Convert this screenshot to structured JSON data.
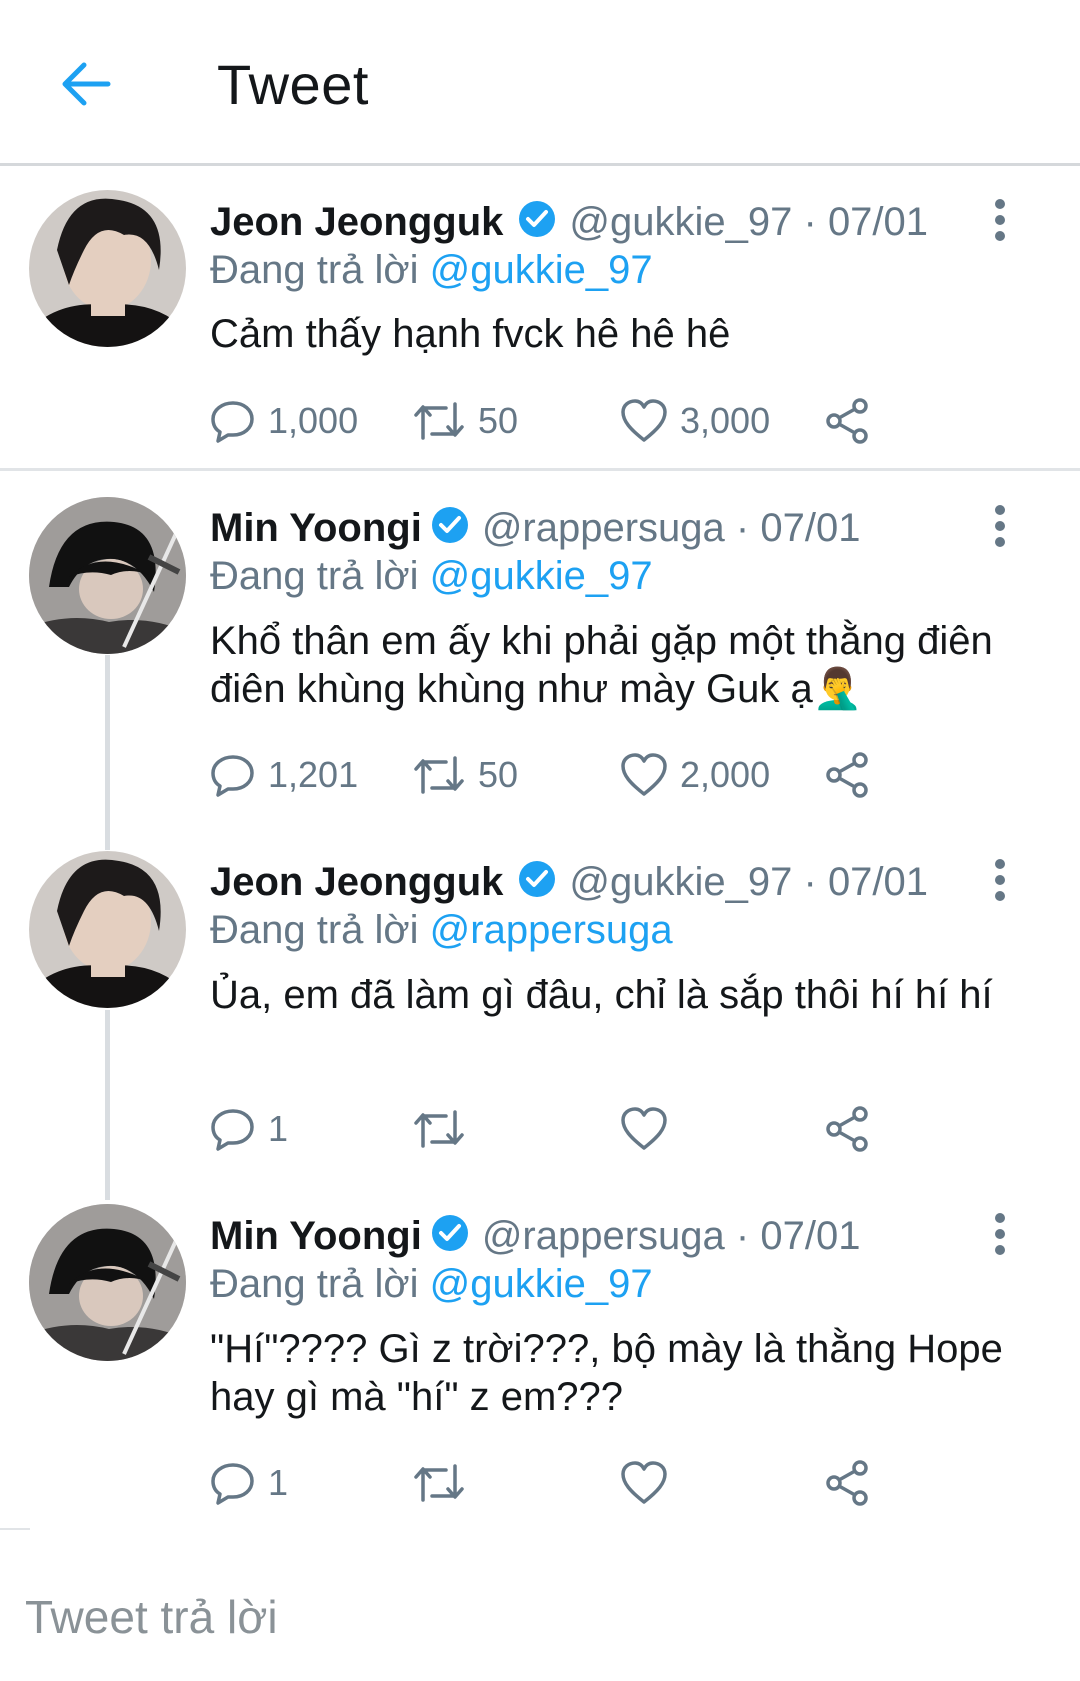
{
  "header": {
    "title": "Tweet",
    "back_icon": "arrow-left-icon",
    "accent_color": "#1da1f2"
  },
  "tweets": [
    {
      "name": "Jeon Jeongguk",
      "handle": "@gukkie_97",
      "separator": "·",
      "date": "07/01",
      "reply_prefix": "Đang trả lời",
      "reply_to": "@gukkie_97",
      "text": "Cảm thấy hạnh fvck hê hê hê",
      "replies": "1,000",
      "retweets": "50",
      "likes": "3,000"
    },
    {
      "name": "Min Yoongi",
      "handle": "@rappersuga",
      "separator": "·",
      "date": "07/01",
      "reply_prefix": "Đang trả lời",
      "reply_to": "@gukkie_97",
      "text": "Khổ thân em ấy khi phải gặp một thằng điên điên khùng khùng như mày Guk ạ🤦‍♂️",
      "replies": "1,201",
      "retweets": "50",
      "likes": "2,000"
    },
    {
      "name": "Jeon Jeongguk",
      "handle": "@gukkie_97",
      "separator": "·",
      "date": "07/01",
      "reply_prefix": "Đang trả lời",
      "reply_to": "@rappersuga",
      "text": "Ủa, em đã làm gì đâu, chỉ là sắp thôi hí hí hí",
      "replies": "1",
      "retweets": "",
      "likes": ""
    },
    {
      "name": "Min Yoongi",
      "handle": "@rappersuga",
      "separator": "·",
      "date": "07/01",
      "reply_prefix": "Đang trả lời",
      "reply_to": "@gukkie_97",
      "text": "\"Hí\"???? Gì z trời???, bộ mày là thằng Hope hay gì mà \"hí\" z em???",
      "replies": "1",
      "retweets": "",
      "likes": ""
    }
  ],
  "compose": {
    "placeholder": "Tweet trả lời"
  },
  "icons": {
    "verified": "verified-badge-icon",
    "more": "more-vertical-icon",
    "reply": "reply-bubble-icon",
    "retweet": "retweet-icon",
    "like": "heart-icon",
    "share": "share-icon"
  }
}
